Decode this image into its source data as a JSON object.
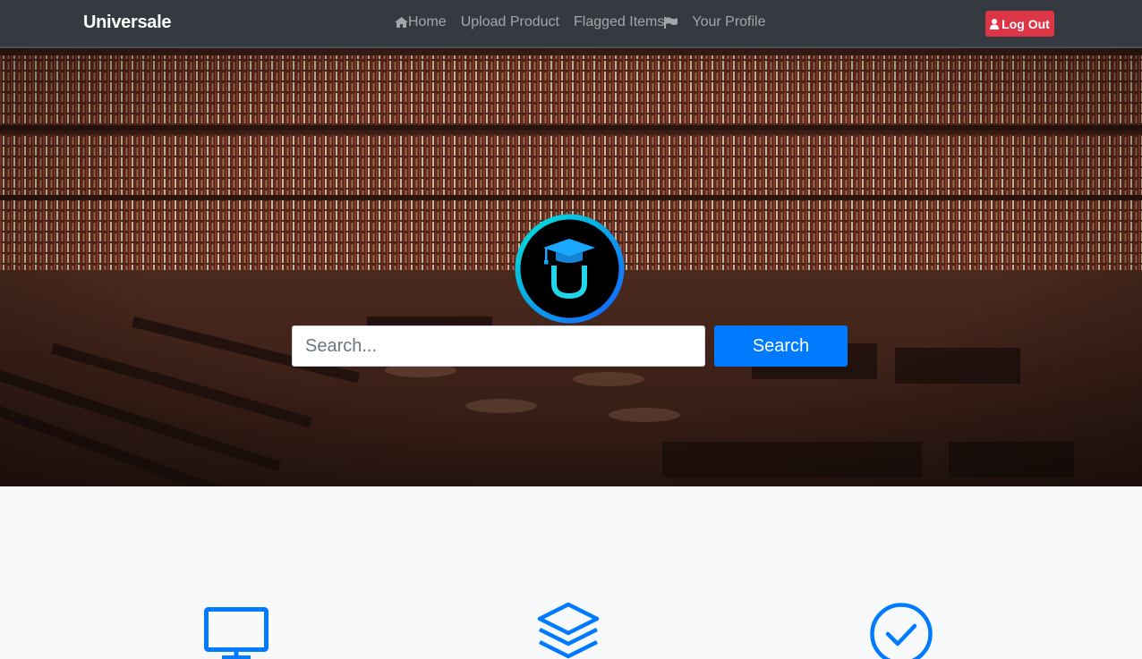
{
  "navbar": {
    "brand": "Universale",
    "links": [
      {
        "label": "Home",
        "icon": "home-icon"
      },
      {
        "label": "Upload Product"
      },
      {
        "label": "Flagged Items",
        "icon": "flag-icon"
      },
      {
        "label": "Your Profile"
      }
    ],
    "logout": {
      "label": "Log Out",
      "icon": "user-icon"
    }
  },
  "hero": {
    "background": "library-photo",
    "logo_icon": "graduation-cap-u-logo",
    "search": {
      "placeholder": "Search...",
      "value": "",
      "button_label": "Search"
    }
  },
  "features": [
    {
      "icon": "desktop-icon"
    },
    {
      "icon": "layers-icon"
    },
    {
      "icon": "check-circle-icon"
    }
  ],
  "colors": {
    "navbar": "#343a40",
    "primary": "#007bff",
    "danger": "#dc3545",
    "logo_ring": "#1aa8ff"
  }
}
